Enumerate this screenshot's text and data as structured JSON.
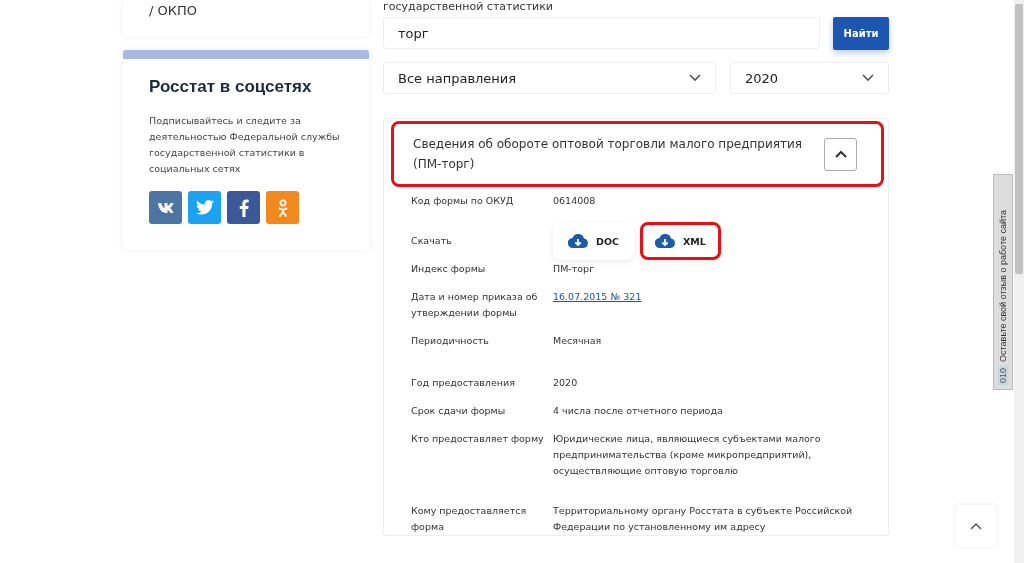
{
  "sidebar": {
    "top_card_text": "/ ОКПО",
    "social_card": {
      "title": "Росстат в соцсетях",
      "text": "Подписывайтесь и следите за деятельностью Федеральной службы государственной статистики в социальных сетях",
      "links": [
        {
          "kind": "vk",
          "color": "#4c75a3"
        },
        {
          "kind": "twitter",
          "color": "#1da1f2"
        },
        {
          "kind": "facebook",
          "color": "#3b5998"
        },
        {
          "kind": "ok",
          "color": "#f2891f"
        }
      ]
    }
  },
  "search": {
    "intro_text": "государственной статистики",
    "query": "торг",
    "button": "Найти",
    "direction_select": "Все направления",
    "year_select": "2020"
  },
  "form_card": {
    "title": "Сведения об обороте оптовой торговли малого предприятия (ПМ-торг)",
    "expanded": true,
    "highlighted": true,
    "fields": [
      {
        "kind": "text",
        "label": "Код формы по ОКУД",
        "value": "0614008"
      },
      {
        "kind": "downloads",
        "label": "Скачать",
        "files": [
          {
            "label": "DOC",
            "highlighted": false
          },
          {
            "label": "XML",
            "highlighted": true
          }
        ]
      },
      {
        "kind": "text",
        "label": "Индекс формы",
        "value": "ПМ-торг"
      },
      {
        "kind": "link",
        "label": "Дата и номер приказа об утверждении формы",
        "value": "16.07.2015 № 321"
      },
      {
        "kind": "text",
        "label": "Периодичность",
        "value": "Месячная"
      },
      {
        "kind": "text",
        "label": "Год предоставления",
        "value": "2020"
      },
      {
        "kind": "text",
        "label": "Срок сдачи формы",
        "value": "4 числа после отчетного периода"
      },
      {
        "kind": "text",
        "label": "Кто предоставляет форму",
        "value": "Юридические лица, являющиеся субъектами малого предпринимательства (кроме микропредприятий), осуществляющие оптовую торговлю"
      },
      {
        "kind": "text",
        "label": "Кому предоставляется форма",
        "value": "Территориальному органу Росстата в субъекте Российской Федерации по установленному им адресу"
      }
    ]
  },
  "feedback_tab": {
    "badge": "010",
    "text": "Оставьте свой отзыв о работе сайта"
  }
}
